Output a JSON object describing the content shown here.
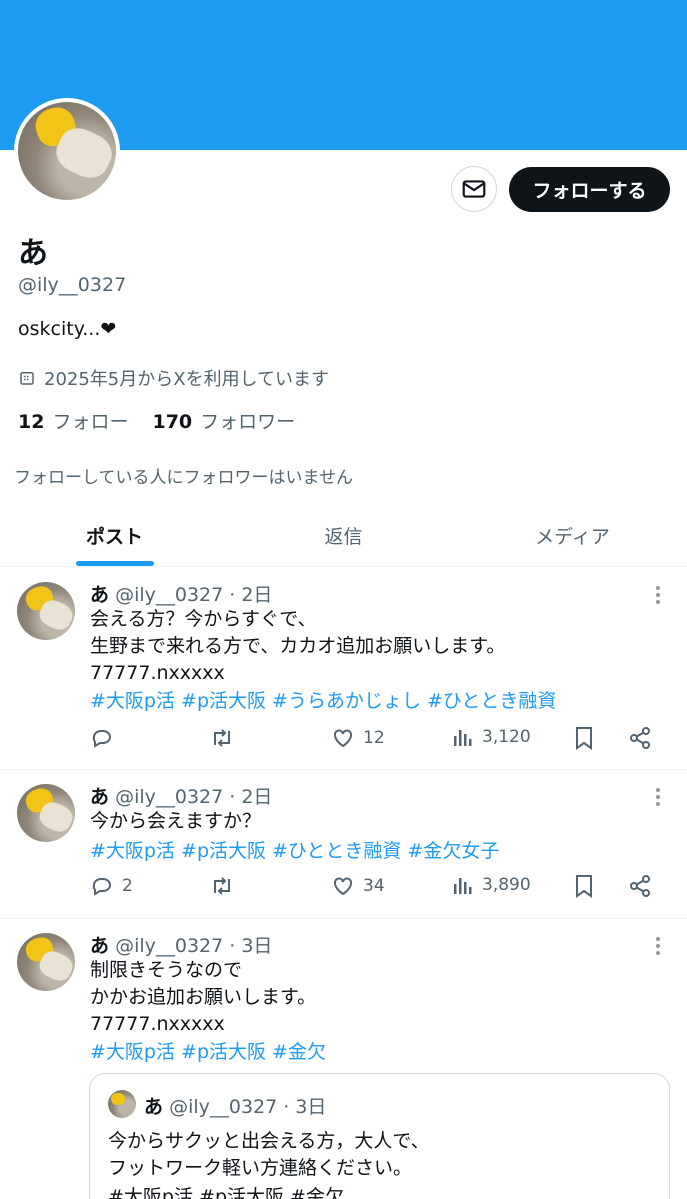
{
  "profile": {
    "name": "あ",
    "handle": "@ily__0327",
    "bio": "oskcity...❤",
    "joined": "2025年5月からXを利用しています",
    "following_count": "12",
    "following_label": "フォロー",
    "followers_count": "170",
    "followers_label": "フォロワー",
    "mutual_note": "フォローしている人にフォロワーはいません",
    "follow_button": "フォローする"
  },
  "tabs": [
    {
      "label": "ポスト",
      "active": true
    },
    {
      "label": "返信",
      "active": false
    },
    {
      "label": "メディア",
      "active": false
    }
  ],
  "posts": [
    {
      "name": "あ",
      "meta": "@ily__0327 · 2日",
      "lines": [
        "会える方？今からすぐで、",
        "生野まで来れる方で、カカオ追加お願いします。",
        "77777.nxxxxx"
      ],
      "tags": "#大阪p活 #p活大阪 #うらあかじょし #ひととき融資",
      "replies": "",
      "likes": "12",
      "views": "3,120"
    },
    {
      "name": "あ",
      "meta": "@ily__0327 · 2日",
      "lines": [
        "今から会えますか？"
      ],
      "tags": "#大阪p活 #p活大阪 #ひととき融資 #金欠女子",
      "replies": "2",
      "likes": "34",
      "views": "3,890"
    },
    {
      "name": "あ",
      "meta": "@ily__0327 · 3日",
      "lines": [
        "制限きそうなので",
        "かかお追加お願いします。",
        "77777.nxxxxx"
      ],
      "tags": "#大阪p活 #p活大阪 #金欠",
      "quote": {
        "name": "あ",
        "meta": "@ily__0327 · 3日",
        "lines": [
          "今からサクッと出会える方，大人で、",
          "フットワーク軽い方連絡ください。"
        ],
        "tags": "#大阪p活 #p活大阪 #金欠"
      }
    }
  ],
  "colors": {
    "banner": "#1d9bf0",
    "link": "#1d9bf0",
    "muted": "#536471",
    "button_dark": "#0f1419"
  },
  "icons": [
    "mail-icon",
    "calendar-icon",
    "reply-icon",
    "repost-icon",
    "like-icon",
    "views-icon",
    "bookmark-icon",
    "share-icon",
    "more-icon"
  ]
}
